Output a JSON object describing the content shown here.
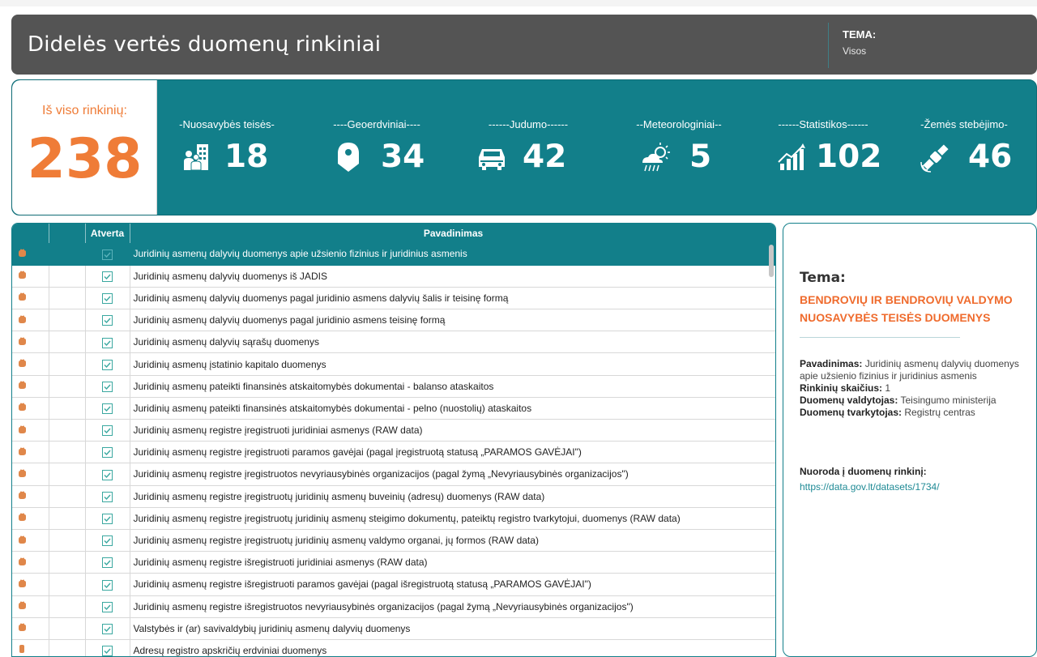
{
  "header": {
    "title": "Didelės vertės duomenų rinkiniai",
    "tema_label": "TEMA:",
    "tema_value": "Visos"
  },
  "total": {
    "label": "Iš viso rinkinių:",
    "value": "238"
  },
  "stats": [
    {
      "caption": "-Nuosavybės teisės-",
      "value": "18",
      "icon": "people-building-icon"
    },
    {
      "caption": "----Geoerdviniai----",
      "value": "34",
      "icon": "map-pin-icon"
    },
    {
      "caption": "------Judumo------",
      "value": "42",
      "icon": "car-icon"
    },
    {
      "caption": "--Meteorologiniai--",
      "value": "5",
      "icon": "weather-icon"
    },
    {
      "caption": "------Statistikos------",
      "value": "102",
      "icon": "chart-icon"
    },
    {
      "caption": "-Žemės stebėjimo-",
      "value": "46",
      "icon": "satellite-icon"
    }
  ],
  "table": {
    "headers": [
      "",
      "",
      "Atverta",
      "Pavadinimas"
    ],
    "rows": [
      "Juridinių asmenų dalyvių duomenys apie užsienio fizinius ir juridinius asmenis",
      "Juridinių asmenų dalyvių duomenys iš JADIS",
      "Juridinių asmenų dalyvių duomenys pagal juridinio asmens dalyvių šalis ir teisinę formą",
      "Juridinių asmenų dalyvių duomenys pagal juridinio asmens teisinę formą",
      "Juridinių asmenų dalyvių sąrašų duomenys",
      "Juridinių asmenų įstatinio kapitalo duomenys",
      "Juridinių asmenų pateikti finansinės atskaitomybės dokumentai - balanso ataskaitos",
      "Juridinių asmenų pateikti finansinės atskaitomybės dokumentai - pelno (nuostolių) ataskaitos",
      "Juridinių asmenų registre įregistruoti juridiniai asmenys (RAW data)",
      "Juridinių asmenų registre įregistruoti paramos gavėjai (pagal įregistruotą statusą „PARAMOS GAVĖJAI\")",
      "Juridinių asmenų registre įregistruotos nevyriausybinės organizacijos (pagal žymą „Nevyriausybinės organizacijos\")",
      "Juridinių asmenų registre įregistruotų juridinių asmenų buveinių (adresų) duomenys (RAW data)",
      "Juridinių asmenų registre įregistruotų juridinių asmenų steigimo dokumentų, pateiktų registro tvarkytojui, duomenys (RAW data)",
      "Juridinių asmenų registre įregistruotų juridinių asmenų valdymo organai, jų formos (RAW data)",
      "Juridinių asmenų registre išregistruoti juridiniai asmenys (RAW data)",
      "Juridinių asmenų registre išregistruoti paramos gavėjai (pagal išregistruotą statusą „PARAMOS GAVĖJAI\")",
      "Juridinių asmenų registre išregistruotos nevyriausybinės organizacijos (pagal žymą „Nevyriausybinės organizacijos\")",
      "Valstybės ir (ar) savivaldybių juridinių asmenų dalyvių duomenys",
      "Adresų registro apskričių erdviniai duomenys"
    ]
  },
  "detail": {
    "tema_label": "Tema:",
    "tema_value": "BENDROVIŲ IR BENDROVIŲ VALDYMO NUOSAVYBĖS TEISĖS DUOMENYS",
    "name_label": "Pavadinimas:",
    "name_value": "Juridinių asmenų dalyvių duomenys apie užsienio fizinius ir juridinius asmenis",
    "count_label": "Rinkinių skaičius:",
    "count_value": "1",
    "owner_label": "Duomenų valdytojas:",
    "owner_value": "Teisingumo ministerija",
    "manager_label": "Duomenų tvarkytojas:",
    "manager_value": "Registrų centras",
    "link_label": "Nuoroda į duomenų rinkinį:",
    "link_value": "https://data.gov.lt/datasets/1734/"
  },
  "colors": {
    "teal": "#127f8a",
    "orange": "#ef7c37",
    "header": "#545454"
  }
}
